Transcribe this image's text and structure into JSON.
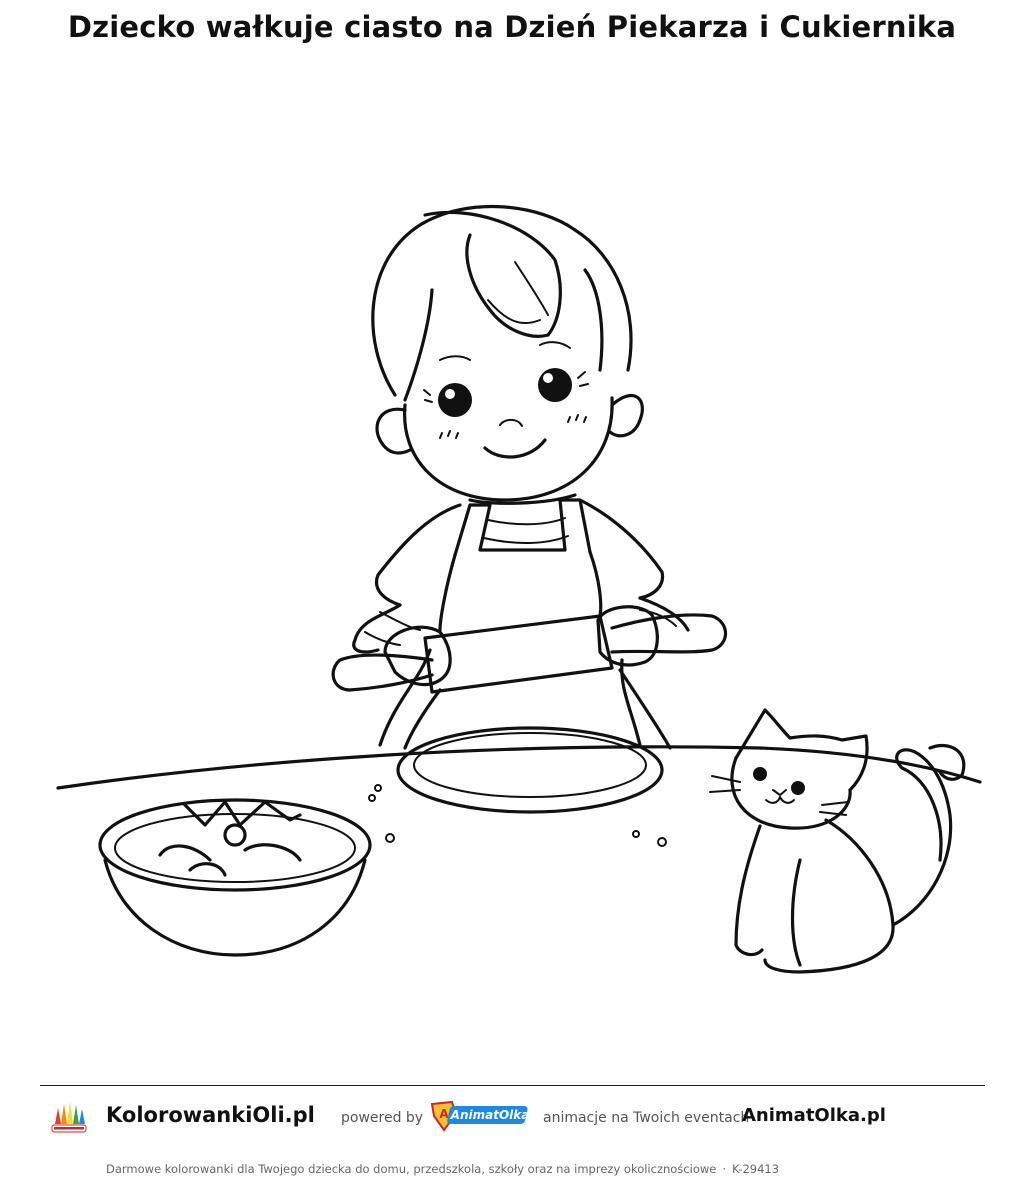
{
  "page": {
    "title": "Dziecko wałkuje ciasto na Dzień Piekarza i Cukiernika"
  },
  "footer": {
    "site_name": "KolorowankiOli.pl",
    "powered_by": "powered by",
    "partner_logo_text": "AnimatOlka",
    "partner_tagline": "animacje na Twoich eventach",
    "partner_site": "AnimatOlka.pl",
    "disclaimer": "Darmowe kolorowanki dla Twojego dziecka do domu, przedszkola, szkoły oraz na imprezy okolicznościowe",
    "separator": "·",
    "code": "K-29413"
  },
  "icons": {
    "site_logo": "kolorowanki-oli-logo-icon",
    "partner_logo": "animatolka-logo-icon"
  }
}
